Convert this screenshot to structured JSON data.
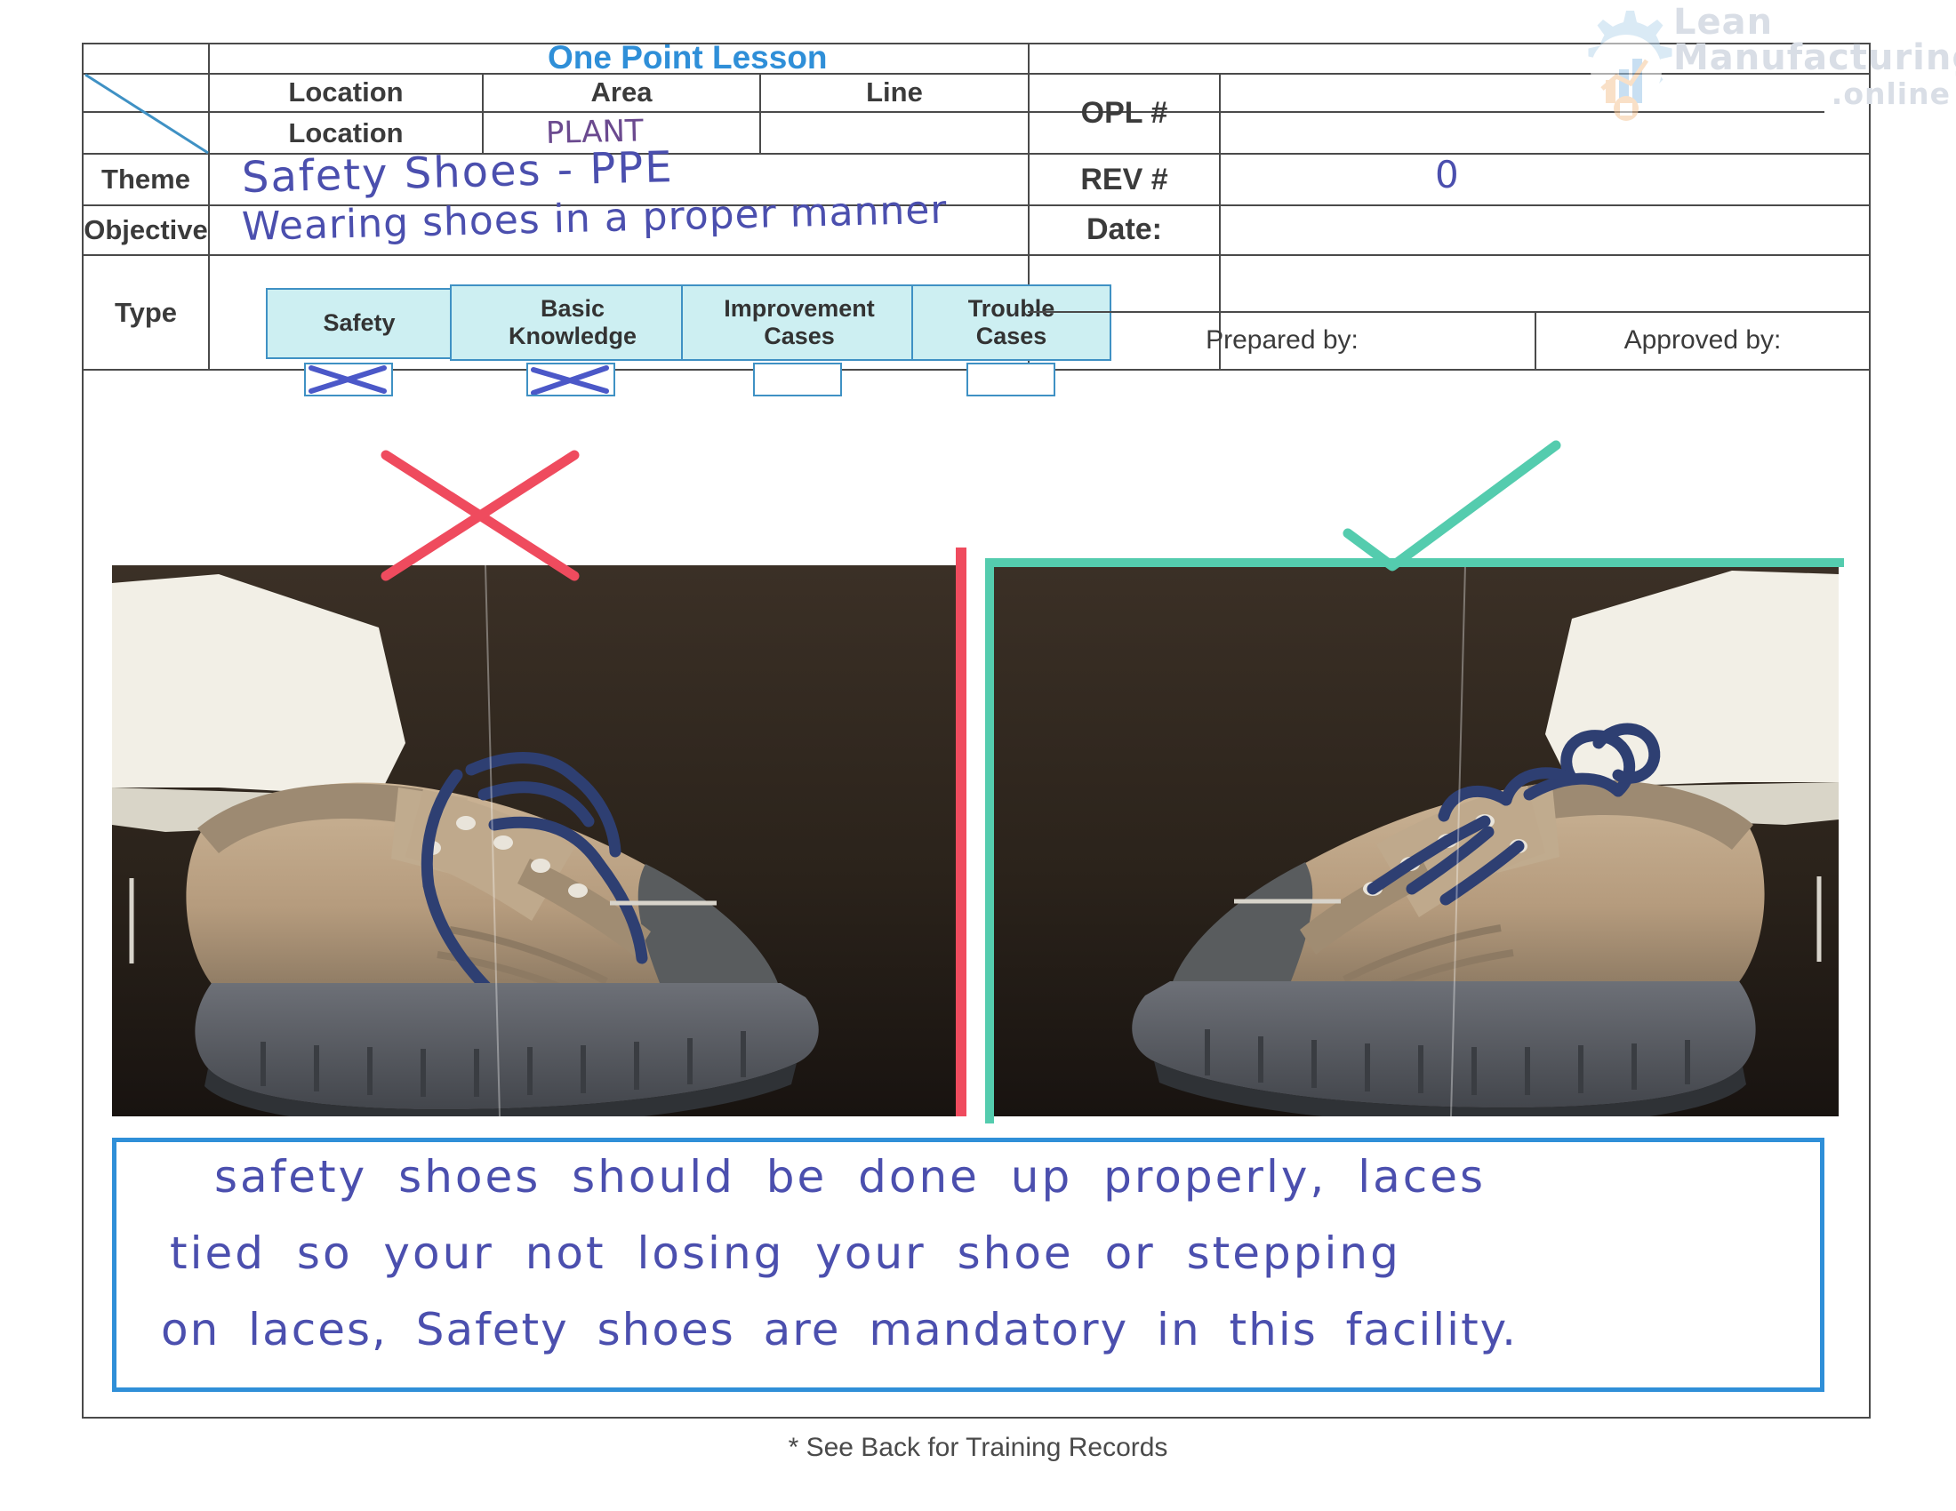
{
  "watermark": {
    "line1": "Lean",
    "line2": "Manufacturing",
    "line3": ".online",
    "color": "#d9dee6",
    "logo_icon": "gear-chart-logo-icon"
  },
  "document": {
    "title": "One Point Lesson",
    "title_color": "#2f8fd8",
    "footer_note": "* See Back for Training Records"
  },
  "header_table": {
    "column_headers": {
      "location": "Location",
      "area": "Area",
      "line": "Line"
    },
    "subrow": {
      "location_label": "Location",
      "location_value": "",
      "area_value": "PLANT",
      "line_value": ""
    },
    "rows": [
      {
        "label": "Theme",
        "value": "Safety Shoes - PPE"
      },
      {
        "label": "Objective",
        "value": "Wearing shoes in a proper manner"
      }
    ],
    "type_row_label": "Type"
  },
  "meta_panel": {
    "opl_label": "OPL #",
    "opl_value": "",
    "rev_label": "REV #",
    "rev_value": "0",
    "date_label": "Date:",
    "date_value": "",
    "prepared_by_label": "Prepared by:",
    "prepared_by_value": "",
    "approved_by_label": "Approved by:",
    "approved_by_value": ""
  },
  "type_options": [
    {
      "label_line1": "Safety",
      "label_line2": "",
      "checked": true,
      "mark": "x-mark"
    },
    {
      "label_line1": "Basic",
      "label_line2": "Knowledge",
      "checked": true,
      "mark": "x-mark"
    },
    {
      "label_line1": "Improvement",
      "label_line2": "Cases",
      "checked": false,
      "mark": ""
    },
    {
      "label_line1": "Trouble",
      "label_line2": "Cases",
      "checked": false,
      "mark": ""
    }
  ],
  "examples": {
    "bad": {
      "annotation": "red-x-icon",
      "annotation_color": "#ef4b5e",
      "border_color": "#ef4b5e",
      "caption": "",
      "photo_alt": "safety shoe with laces untied"
    },
    "good": {
      "annotation": "green-check-icon",
      "annotation_color": "#54ccae",
      "border_color": "#54ccae",
      "caption": "",
      "photo_alt": "safety shoe with laces tied properly"
    }
  },
  "handwritten_note": {
    "line1": "safety shoes should be done up properly, laces",
    "line2": "tied so your not losing your shoe or stepping",
    "line3": "on laces, Safety shoes are mandatory in this facility.",
    "ink_color": "#4b58c8",
    "border_color": "#2f8fd8"
  }
}
